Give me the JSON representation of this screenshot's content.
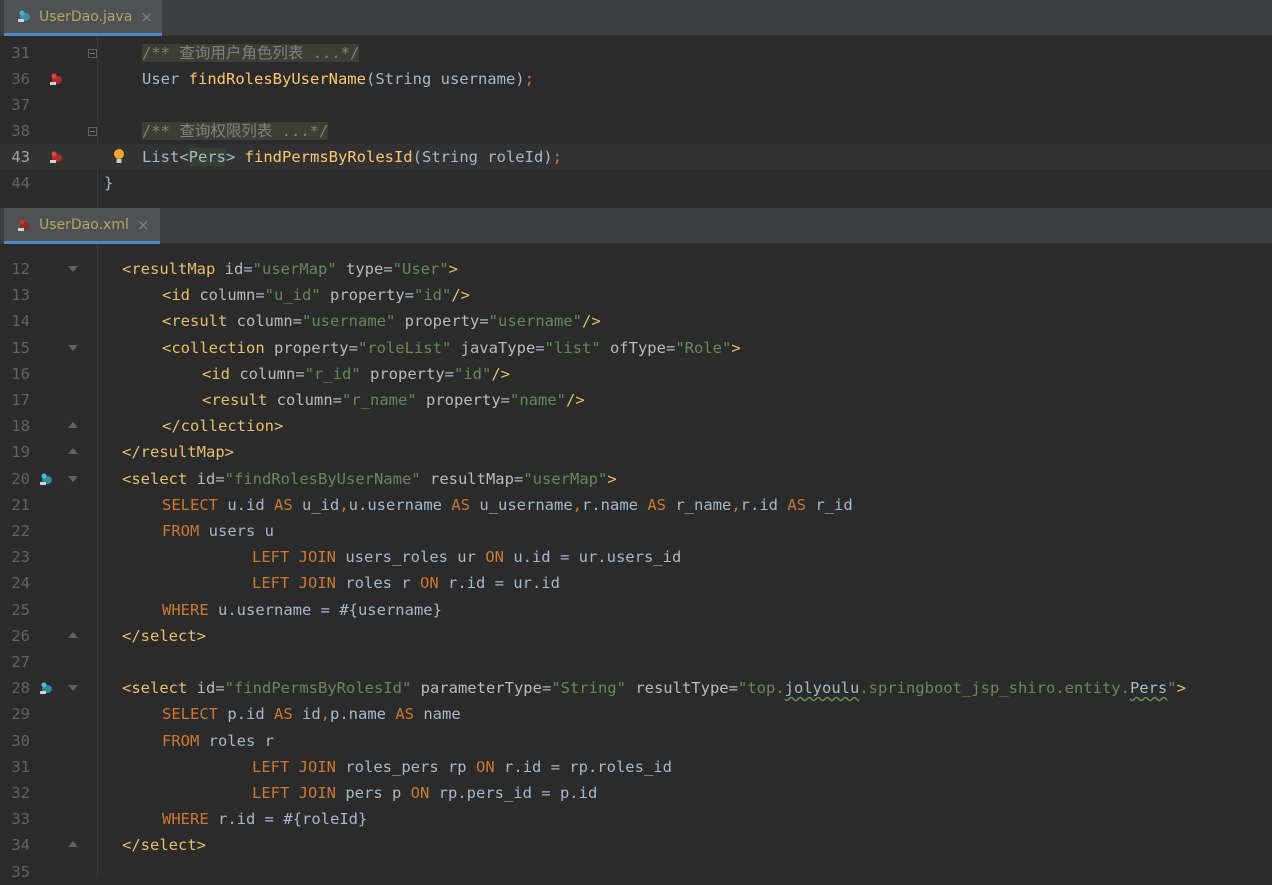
{
  "top_tab": {
    "label": "UserDao.java",
    "close": "×"
  },
  "bottom_tab": {
    "label": "UserDao.xml",
    "close": "×"
  },
  "java_lines": [
    {
      "n": "31",
      "parts": [
        [
          "cm",
          "/** 查询用户角色列表 ...*/"
        ]
      ]
    },
    {
      "n": "36",
      "parts": [
        [
          "typ",
          "User "
        ],
        [
          "fn",
          "findRolesByUserName"
        ],
        [
          "typ",
          "(String username)"
        ],
        [
          "sep",
          ";"
        ]
      ]
    },
    {
      "n": "37",
      "parts": []
    },
    {
      "n": "38",
      "parts": [
        [
          "cm",
          "/** 查询权限列表 ...*/"
        ]
      ]
    },
    {
      "n": "43",
      "parts": [
        [
          "typ",
          "List<"
        ],
        [
          "gen",
          "Pers"
        ],
        [
          "typ",
          "> "
        ],
        [
          "fn",
          "findPermsByRolesId"
        ],
        [
          "typ",
          "(String roleId)"
        ],
        [
          "sep",
          ";"
        ]
      ]
    },
    {
      "n": "44",
      "parts": [
        [
          "typ",
          "}"
        ]
      ]
    }
  ],
  "xml_lines": [
    {
      "n": "12",
      "parts": [
        [
          "tag",
          "<resultMap "
        ],
        [
          "attr",
          "id"
        ],
        [
          "typ",
          "="
        ],
        [
          "str",
          "\"userMap\" "
        ],
        [
          "attr",
          "type"
        ],
        [
          "typ",
          "="
        ],
        [
          "str",
          "\"User\""
        ],
        [
          "tag",
          ">"
        ]
      ]
    },
    {
      "n": "13",
      "parts": [
        [
          "tag",
          "<id "
        ],
        [
          "attr",
          "column"
        ],
        [
          "typ",
          "="
        ],
        [
          "str",
          "\"u_id\" "
        ],
        [
          "attr",
          "property"
        ],
        [
          "typ",
          "="
        ],
        [
          "str",
          "\"id\""
        ],
        [
          "tag",
          "/>"
        ]
      ]
    },
    {
      "n": "14",
      "parts": [
        [
          "tag",
          "<result "
        ],
        [
          "attr",
          "column"
        ],
        [
          "typ",
          "="
        ],
        [
          "str",
          "\"username\" "
        ],
        [
          "attr",
          "property"
        ],
        [
          "typ",
          "="
        ],
        [
          "str",
          "\"username\""
        ],
        [
          "tag",
          "/>"
        ]
      ]
    },
    {
      "n": "15",
      "parts": [
        [
          "tag",
          "<collection "
        ],
        [
          "attr",
          "property"
        ],
        [
          "typ",
          "="
        ],
        [
          "str",
          "\"roleList\" "
        ],
        [
          "attr",
          "javaType"
        ],
        [
          "typ",
          "="
        ],
        [
          "str",
          "\"list\" "
        ],
        [
          "attr",
          "ofType"
        ],
        [
          "typ",
          "="
        ],
        [
          "str",
          "\"Role\""
        ],
        [
          "tag",
          ">"
        ]
      ]
    },
    {
      "n": "16",
      "parts": [
        [
          "tag",
          "<id "
        ],
        [
          "attr",
          "column"
        ],
        [
          "typ",
          "="
        ],
        [
          "str",
          "\"r_id\" "
        ],
        [
          "attr",
          "property"
        ],
        [
          "typ",
          "="
        ],
        [
          "str",
          "\"id\""
        ],
        [
          "tag",
          "/>"
        ]
      ]
    },
    {
      "n": "17",
      "parts": [
        [
          "tag",
          "<result "
        ],
        [
          "attr",
          "column"
        ],
        [
          "typ",
          "="
        ],
        [
          "str",
          "\"r_name\" "
        ],
        [
          "attr",
          "property"
        ],
        [
          "typ",
          "="
        ],
        [
          "str",
          "\"name\""
        ],
        [
          "tag",
          "/>"
        ]
      ]
    },
    {
      "n": "18",
      "parts": [
        [
          "tag",
          "</collection>"
        ]
      ]
    },
    {
      "n": "19",
      "parts": [
        [
          "tag",
          "</resultMap>"
        ]
      ]
    },
    {
      "n": "20",
      "parts": [
        [
          "tag",
          "<select "
        ],
        [
          "attr",
          "id"
        ],
        [
          "typ",
          "="
        ],
        [
          "str",
          "\"findRolesByUserName\" "
        ],
        [
          "attr",
          "resultMap"
        ],
        [
          "typ",
          "="
        ],
        [
          "str",
          "\"userMap\""
        ],
        [
          "tag",
          ">"
        ]
      ]
    },
    {
      "n": "21",
      "parts": [
        [
          "kw",
          "SELECT "
        ],
        [
          "typ",
          "u.id "
        ],
        [
          "kw",
          "AS "
        ],
        [
          "typ",
          "u_id"
        ],
        [
          "kw",
          ","
        ],
        [
          "typ",
          "u.username "
        ],
        [
          "kw",
          "AS "
        ],
        [
          "typ",
          "u_username"
        ],
        [
          "kw",
          ","
        ],
        [
          "typ",
          "r.name "
        ],
        [
          "kw",
          "AS "
        ],
        [
          "typ",
          "r_name"
        ],
        [
          "kw",
          ","
        ],
        [
          "typ",
          "r.id "
        ],
        [
          "kw",
          "AS "
        ],
        [
          "typ",
          "r_id"
        ]
      ]
    },
    {
      "n": "22",
      "parts": [
        [
          "kw",
          "FROM "
        ],
        [
          "typ",
          "users u"
        ]
      ]
    },
    {
      "n": "23",
      "parts": [
        [
          "kw",
          "LEFT JOIN "
        ],
        [
          "typ",
          "users_roles ur "
        ],
        [
          "kw",
          "ON "
        ],
        [
          "typ",
          "u.id = ur.users_id"
        ]
      ]
    },
    {
      "n": "24",
      "parts": [
        [
          "kw",
          "LEFT JOIN "
        ],
        [
          "typ",
          "roles r "
        ],
        [
          "kw",
          "ON "
        ],
        [
          "typ",
          "r.id = ur.id"
        ]
      ]
    },
    {
      "n": "25",
      "parts": [
        [
          "kw",
          "WHERE "
        ],
        [
          "typ",
          "u.username = #{username}"
        ]
      ]
    },
    {
      "n": "26",
      "parts": [
        [
          "tag",
          "</select>"
        ]
      ]
    },
    {
      "n": "27",
      "parts": []
    },
    {
      "n": "28",
      "parts": [
        [
          "tag",
          "<select "
        ],
        [
          "attr",
          "id"
        ],
        [
          "typ",
          "="
        ],
        [
          "str",
          "\"findPermsByRolesId\" "
        ],
        [
          "attr",
          "parameterType"
        ],
        [
          "typ",
          "="
        ],
        [
          "str",
          "\"String\" "
        ],
        [
          "attr",
          "resultType"
        ],
        [
          "typ",
          "="
        ],
        [
          "str",
          "\"top."
        ],
        [
          "squig",
          "jolyoulu"
        ],
        [
          "str",
          ".springboot_jsp_shiro.entity."
        ],
        [
          "squig",
          "Pers"
        ],
        [
          "str",
          "\""
        ],
        [
          "tag",
          ">"
        ]
      ]
    },
    {
      "n": "29",
      "parts": [
        [
          "kw",
          "SELECT "
        ],
        [
          "typ",
          "p.id "
        ],
        [
          "kw",
          "AS "
        ],
        [
          "typ",
          "id"
        ],
        [
          "kw",
          ","
        ],
        [
          "typ",
          "p.name "
        ],
        [
          "kw",
          "AS "
        ],
        [
          "typ",
          "name"
        ]
      ]
    },
    {
      "n": "30",
      "parts": [
        [
          "kw",
          "FROM "
        ],
        [
          "typ",
          "roles r"
        ]
      ]
    },
    {
      "n": "31",
      "parts": [
        [
          "kw",
          "LEFT JOIN "
        ],
        [
          "typ",
          "roles_pers rp "
        ],
        [
          "kw",
          "ON "
        ],
        [
          "typ",
          "r.id = rp.roles_id"
        ]
      ]
    },
    {
      "n": "32",
      "parts": [
        [
          "kw",
          "LEFT JOIN "
        ],
        [
          "typ",
          "pers p "
        ],
        [
          "kw",
          "ON "
        ],
        [
          "typ",
          "rp.pers_id = p.id"
        ]
      ]
    },
    {
      "n": "33",
      "parts": [
        [
          "kw",
          "WHERE "
        ],
        [
          "typ",
          "r.id = #{roleId}"
        ]
      ]
    },
    {
      "n": "34",
      "parts": [
        [
          "tag",
          "</select>"
        ]
      ]
    },
    {
      "n": "35",
      "parts": []
    }
  ]
}
